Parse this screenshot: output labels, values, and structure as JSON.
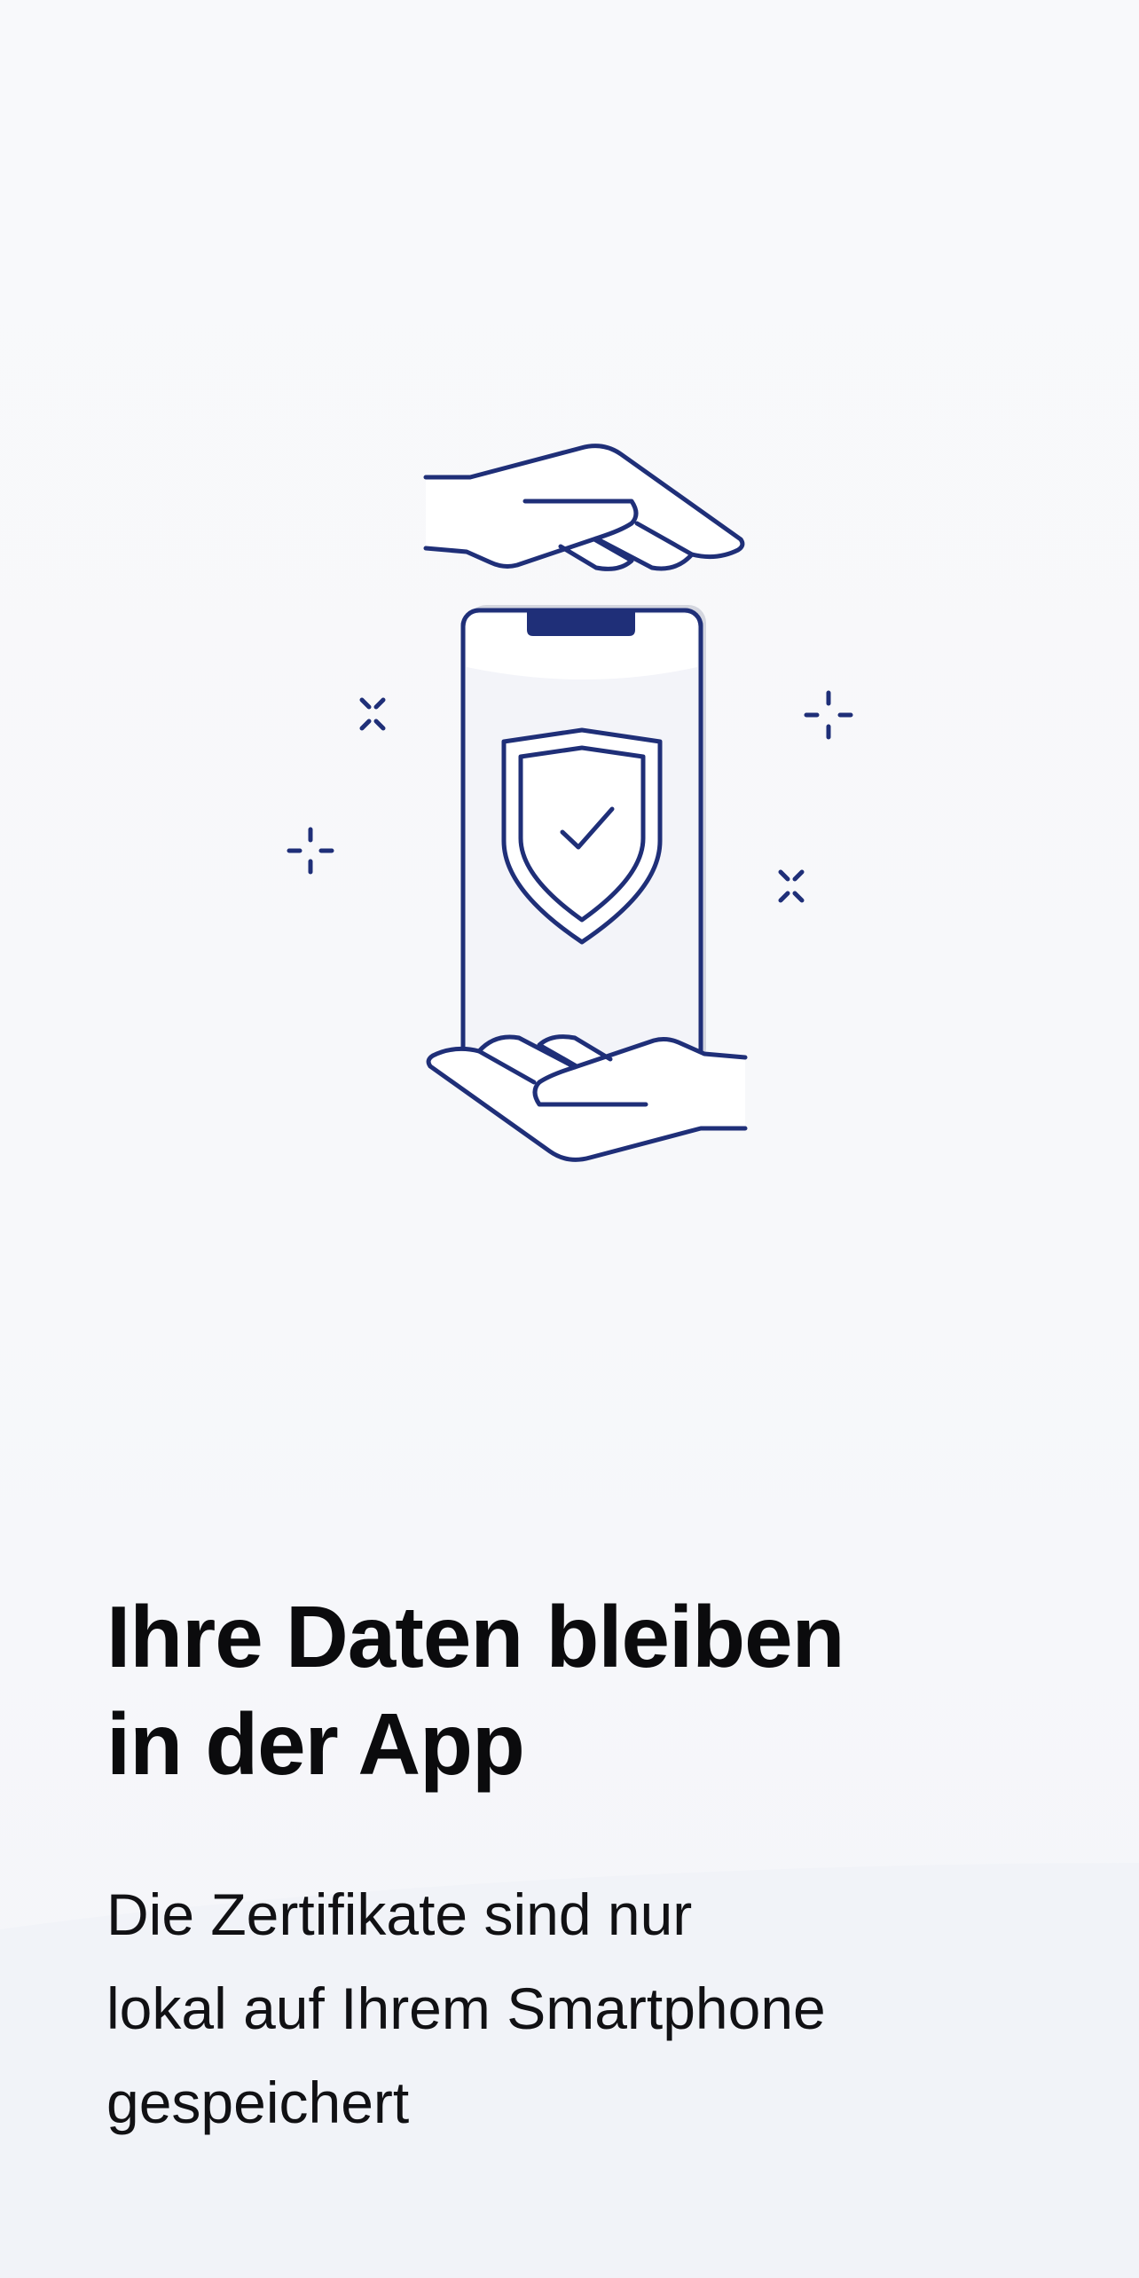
{
  "colors": {
    "background": "#f8f9fb",
    "accent_navy": "#1f2f78",
    "heading": "#0b0b0d",
    "body": "#111114"
  },
  "illustration": {
    "icons": [
      "hand-top-icon",
      "phone-icon",
      "shield-check-icon",
      "hand-bottom-icon",
      "sparkle-icon"
    ]
  },
  "onboarding": {
    "title_lines": [
      "Ihre Daten bleiben",
      "in der App"
    ],
    "description_lines": [
      "Die Zertifikate sind nur",
      "lokal auf Ihrem Smartphone",
      "gespeichert"
    ]
  }
}
